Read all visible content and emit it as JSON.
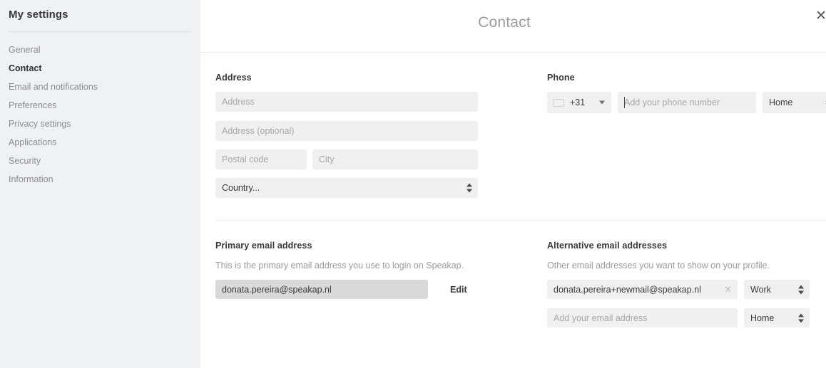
{
  "sidebar": {
    "title": "My settings",
    "items": [
      {
        "label": "General",
        "active": false
      },
      {
        "label": "Contact",
        "active": true
      },
      {
        "label": "Email and notifications",
        "active": false
      },
      {
        "label": "Preferences",
        "active": false
      },
      {
        "label": "Privacy settings",
        "active": false
      },
      {
        "label": "Applications",
        "active": false
      },
      {
        "label": "Security",
        "active": false
      },
      {
        "label": "Information",
        "active": false
      }
    ]
  },
  "header": {
    "title": "Contact",
    "close_icon": "close-icon"
  },
  "address": {
    "label": "Address",
    "street_placeholder": "Address",
    "street_value": "",
    "street2_placeholder": "Address (optional)",
    "street2_value": "",
    "postal_placeholder": "Postal code",
    "postal_value": "",
    "city_placeholder": "City",
    "city_value": "",
    "country_selected": "Country..."
  },
  "phone": {
    "label": "Phone",
    "country_flag": "flag-nl-icon",
    "country_code": "+31",
    "number_placeholder": "Add your phone number",
    "number_value": "",
    "type_selected": "Home"
  },
  "primary_email": {
    "label": "Primary email address",
    "hint": "This is the primary email address you use to login on Speakap.",
    "value": "donata.pereira@speakap.nl",
    "edit_label": "Edit"
  },
  "alternative_emails": {
    "label": "Alternative email addresses",
    "hint": "Other email addresses you want to show on your profile.",
    "rows": [
      {
        "value": "donata.pereira+newmail@speakap.nl",
        "placeholder": "",
        "type": "Work",
        "clear_icon": "×"
      },
      {
        "value": "",
        "placeholder": "Add your email address",
        "type": "Home",
        "clear_icon": ""
      }
    ]
  },
  "colors": {
    "sidebar_bg": "#f0f1f2",
    "field_bg": "#f0f0f1",
    "disabled_field_bg": "#d9d9da",
    "text": "#3b3b3d",
    "muted_text": "#9a9b9e",
    "flag_red": "#ae1c28",
    "flag_blue": "#21468b"
  }
}
